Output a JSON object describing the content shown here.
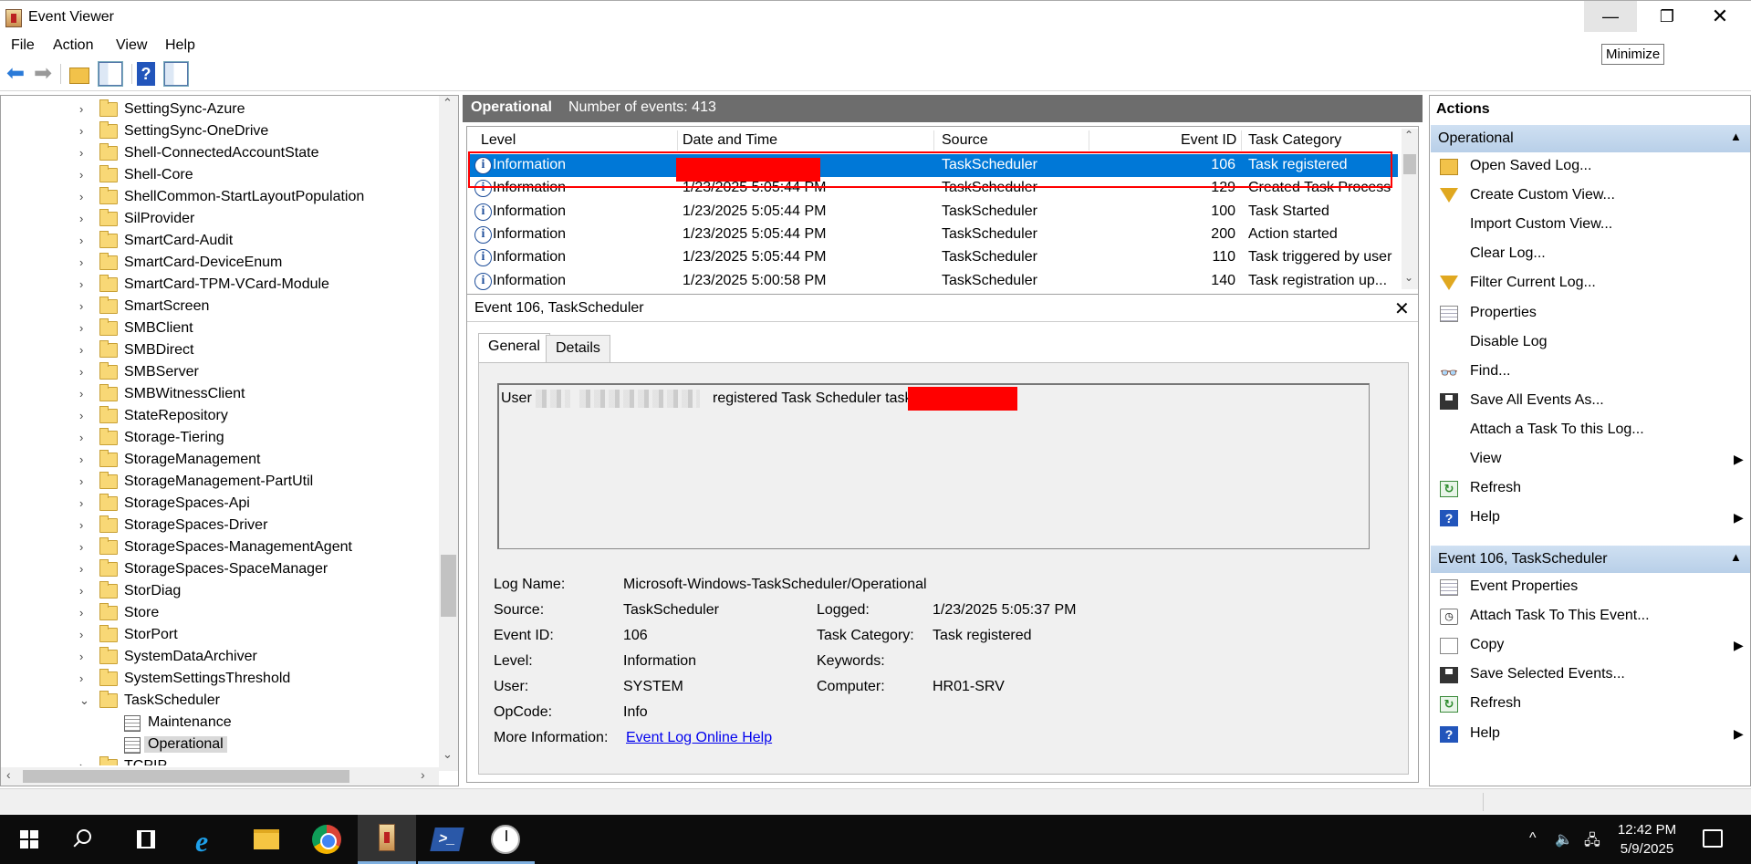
{
  "window": {
    "title": "Event Viewer",
    "minimize_glyph": "—",
    "restore_glyph": "❐",
    "close_glyph": "✕",
    "tooltip": "Minimize"
  },
  "menu": [
    "File",
    "Action",
    "View",
    "Help"
  ],
  "toolbar": {
    "icons": [
      "back-arrow-icon",
      "forward-arrow-icon",
      "open-folder-icon",
      "show-hide-tree-icon",
      "help-icon",
      "show-hide-action-pane-icon"
    ],
    "help_glyph": "?"
  },
  "tree": {
    "chevron_collapsed": "›",
    "chevron_expanded": "⌄",
    "items": [
      {
        "label": "SettingSync-Azure"
      },
      {
        "label": "SettingSync-OneDrive"
      },
      {
        "label": "Shell-ConnectedAccountState"
      },
      {
        "label": "Shell-Core"
      },
      {
        "label": "ShellCommon-StartLayoutPopulation"
      },
      {
        "label": "SilProvider"
      },
      {
        "label": "SmartCard-Audit"
      },
      {
        "label": "SmartCard-DeviceEnum"
      },
      {
        "label": "SmartCard-TPM-VCard-Module"
      },
      {
        "label": "SmartScreen"
      },
      {
        "label": "SMBClient"
      },
      {
        "label": "SMBDirect"
      },
      {
        "label": "SMBServer"
      },
      {
        "label": "SMBWitnessClient"
      },
      {
        "label": "StateRepository"
      },
      {
        "label": "Storage-Tiering"
      },
      {
        "label": "StorageManagement"
      },
      {
        "label": "StorageManagement-PartUtil"
      },
      {
        "label": "StorageSpaces-Api"
      },
      {
        "label": "StorageSpaces-Driver"
      },
      {
        "label": "StorageSpaces-ManagementAgent"
      },
      {
        "label": "StorageSpaces-SpaceManager"
      },
      {
        "label": "StorDiag"
      },
      {
        "label": "Store"
      },
      {
        "label": "StorPort"
      },
      {
        "label": "SystemDataArchiver"
      },
      {
        "label": "SystemSettingsThreshold"
      },
      {
        "label": "TaskScheduler"
      }
    ],
    "children": [
      {
        "label": "Maintenance"
      },
      {
        "label": "Operational"
      }
    ],
    "partial_item": "TCPIP",
    "scroll_up": "⌃",
    "scroll_down": "⌄",
    "scroll_left": "‹",
    "scroll_right": "›"
  },
  "log_header": {
    "name": "Operational",
    "count": "Number of events: 413"
  },
  "event_list": {
    "sort_glyph": "⌃",
    "columns": [
      "Level",
      "Date and Time",
      "Source",
      "Event ID",
      "Task Category"
    ],
    "rows": [
      {
        "level": "Information",
        "datetime": "",
        "source": "TaskScheduler",
        "event_id": "106",
        "category": "Task registered"
      },
      {
        "level": "Information",
        "datetime": "1/23/2025 5:05:44 PM",
        "source": "TaskScheduler",
        "event_id": "129",
        "category": "Created Task Process"
      },
      {
        "level": "Information",
        "datetime": "1/23/2025 5:05:44 PM",
        "source": "TaskScheduler",
        "event_id": "100",
        "category": "Task Started"
      },
      {
        "level": "Information",
        "datetime": "1/23/2025 5:05:44 PM",
        "source": "TaskScheduler",
        "event_id": "200",
        "category": "Action started"
      },
      {
        "level": "Information",
        "datetime": "1/23/2025 5:05:44 PM",
        "source": "TaskScheduler",
        "event_id": "110",
        "category": "Task triggered by user"
      },
      {
        "level": "Information",
        "datetime": "1/23/2025 5:00:58 PM",
        "source": "TaskScheduler",
        "event_id": "140",
        "category": "Task registration up..."
      }
    ],
    "scroll_up": "⌃",
    "scroll_down": "⌄"
  },
  "event_detail": {
    "title": "Event 106, TaskScheduler",
    "close_glyph": "✕",
    "tabs": [
      "General",
      "Details"
    ],
    "description_prefix": "User",
    "description_middle": "registered Task Scheduler task",
    "properties": {
      "log_name_label": "Log Name:",
      "log_name": "Microsoft-Windows-TaskScheduler/Operational",
      "source_label": "Source:",
      "source": "TaskScheduler",
      "logged_label": "Logged:",
      "logged": "1/23/2025 5:05:37 PM",
      "event_id_label": "Event ID:",
      "event_id": "106",
      "task_category_label": "Task Category:",
      "task_category": "Task registered",
      "level_label": "Level:",
      "level": "Information",
      "keywords_label": "Keywords:",
      "keywords": "",
      "user_label": "User:",
      "user": "SYSTEM",
      "computer_label": "Computer:",
      "computer": "HR01-SRV",
      "opcode_label": "OpCode:",
      "opcode": "Info",
      "more_info_label": "More Information:",
      "more_info_link": "Event Log Online Help"
    }
  },
  "actions": {
    "title": "Actions",
    "collapse_glyph": "▲",
    "submenu_glyph": "▶",
    "section1": {
      "label": "Operational",
      "items": [
        {
          "label": "Open Saved Log...",
          "icon": "open-folder-icon"
        },
        {
          "label": "Create Custom View...",
          "icon": "filter-icon"
        },
        {
          "label": "Import Custom View...",
          "icon": ""
        },
        {
          "label": "Clear Log...",
          "icon": ""
        },
        {
          "label": "Filter Current Log...",
          "icon": "filter-icon"
        },
        {
          "label": "Properties",
          "icon": "properties-icon"
        },
        {
          "label": "Disable Log",
          "icon": ""
        },
        {
          "label": "Find...",
          "icon": "binoculars-icon"
        },
        {
          "label": "Save All Events As...",
          "icon": "save-icon"
        },
        {
          "label": "Attach a Task To this Log...",
          "icon": ""
        },
        {
          "label": "View",
          "icon": "",
          "submenu": true
        },
        {
          "label": "Refresh",
          "icon": "refresh-icon"
        },
        {
          "label": "Help",
          "icon": "help-icon",
          "submenu": true
        }
      ]
    },
    "section2": {
      "label": "Event 106, TaskScheduler",
      "items": [
        {
          "label": "Event Properties",
          "icon": "properties-icon"
        },
        {
          "label": "Attach Task To This Event...",
          "icon": "attach-task-icon"
        },
        {
          "label": "Copy",
          "icon": "copy-icon",
          "submenu": true
        },
        {
          "label": "Save Selected Events...",
          "icon": "save-icon"
        },
        {
          "label": "Refresh",
          "icon": "refresh-icon"
        },
        {
          "label": "Help",
          "icon": "help-icon",
          "submenu": true
        }
      ]
    }
  },
  "taskbar": {
    "apps": [
      "start-icon",
      "search-icon",
      "task-view-icon",
      "internet-explorer-icon",
      "file-explorer-icon",
      "chrome-icon",
      "event-viewer-icon",
      "powershell-icon",
      "task-scheduler-icon"
    ],
    "ie_glyph": "e",
    "ps_glyph": ">_",
    "tray_chevron": "^",
    "tray_volume": "🔈",
    "tray_network": "🖧",
    "time": "12:42 PM",
    "date": "5/9/2025"
  }
}
